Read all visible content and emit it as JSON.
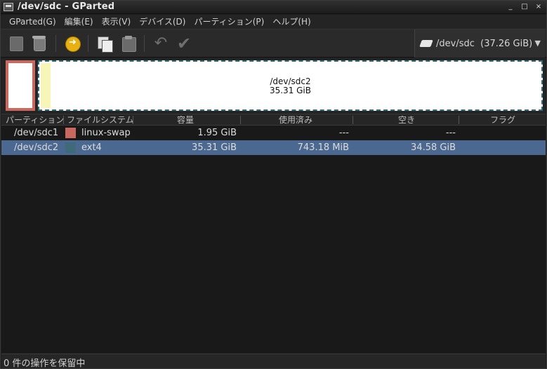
{
  "window": {
    "title": "/dev/sdc - GParted",
    "buttons": [
      "_",
      "□",
      "×"
    ]
  },
  "menubar": {
    "items": [
      "GParted(G)",
      "編集(E)",
      "表示(V)",
      "デバイス(D)",
      "パーティション(P)",
      "ヘルプ(H)"
    ]
  },
  "toolbar": {
    "icons": [
      "new-icon",
      "delete-icon",
      "resize-move-icon",
      "copy-icon",
      "paste-icon",
      "undo-icon",
      "apply-icon"
    ],
    "device": "/dev/sdc  (37.26 GiB)"
  },
  "diskmap": {
    "ext4_name": "/dev/sdc2",
    "ext4_size": "35.31 GiB",
    "swap_color": "#c8685e",
    "ext4_color": "#2f6c78"
  },
  "table": {
    "headers": [
      "パーティション",
      "ファイルシステム",
      "容量",
      "使用済み",
      "空き",
      "フラグ"
    ],
    "rows": [
      {
        "partition": "/dev/sdc1",
        "filesystem": "linux-swap",
        "fs_color": "#c8685e",
        "size": "1.95 GiB",
        "used": "---",
        "unused": "---",
        "flags": ""
      },
      {
        "partition": "/dev/sdc2",
        "filesystem": "ext4",
        "fs_color": "#3f6a7a",
        "size": "35.31 GiB",
        "used": "743.18 MiB",
        "unused": "34.58 GiB",
        "flags": "",
        "selected": true
      }
    ]
  },
  "statusbar": {
    "text": "0 件の操作を保留中"
  }
}
